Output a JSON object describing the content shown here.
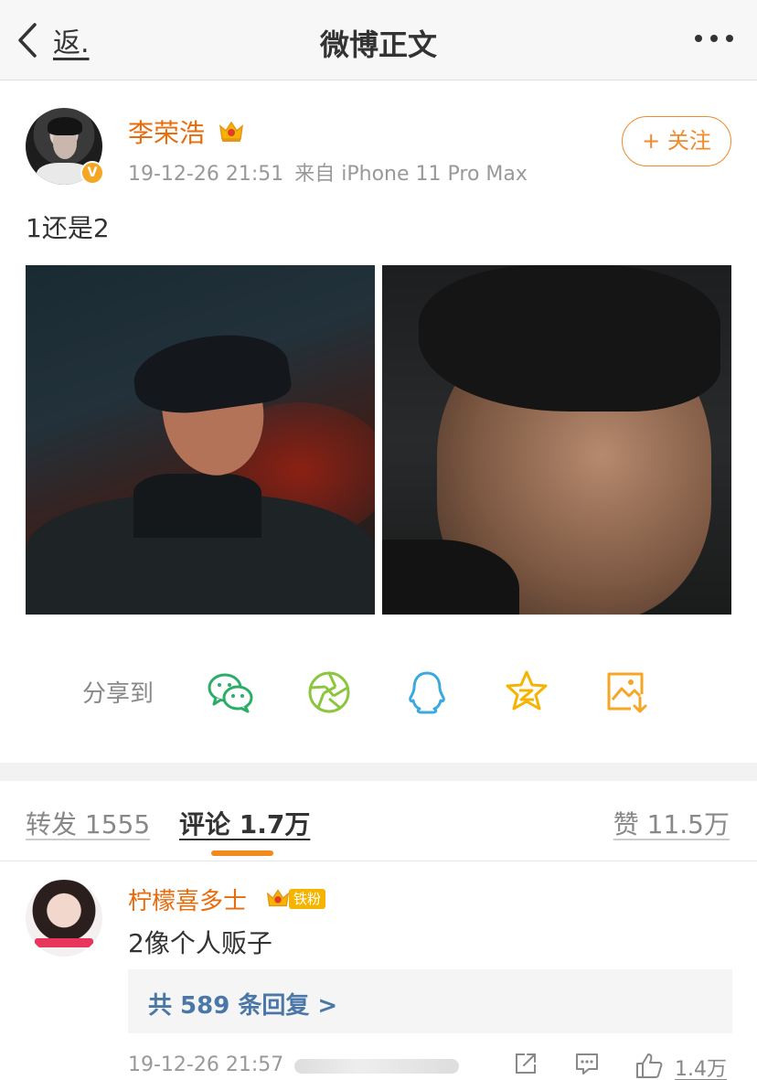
{
  "header": {
    "back_label": "返.",
    "title": "微博正文"
  },
  "post": {
    "username": "李荣浩",
    "verified_badge": "V",
    "timestamp": "19-12-26 21:51",
    "source": "来自 iPhone 11 Pro Max",
    "follow_label": "+ 关注",
    "text": "1还是2",
    "images": [
      "photo-1",
      "photo-2"
    ]
  },
  "share": {
    "label": "分享到",
    "targets": [
      "wechat-icon",
      "moments-icon",
      "qq-icon",
      "qzone-icon",
      "save-image-icon"
    ]
  },
  "tabs": {
    "repost": "转发 1555",
    "comments": "评论 1.7万",
    "likes": "赞 11.5万"
  },
  "comment": {
    "username": "柠檬喜多士",
    "fan_badge": "铁粉",
    "text": "2像个人贩子",
    "replies_label": "共 589 条回复 >",
    "timestamp": "19-12-26 21:57",
    "like_count": "1.4万"
  },
  "colors": {
    "username": "#e86b0c",
    "follow": "#f08a2a",
    "tab_indicator": "#f28a1e",
    "link": "#4a77a8"
  }
}
